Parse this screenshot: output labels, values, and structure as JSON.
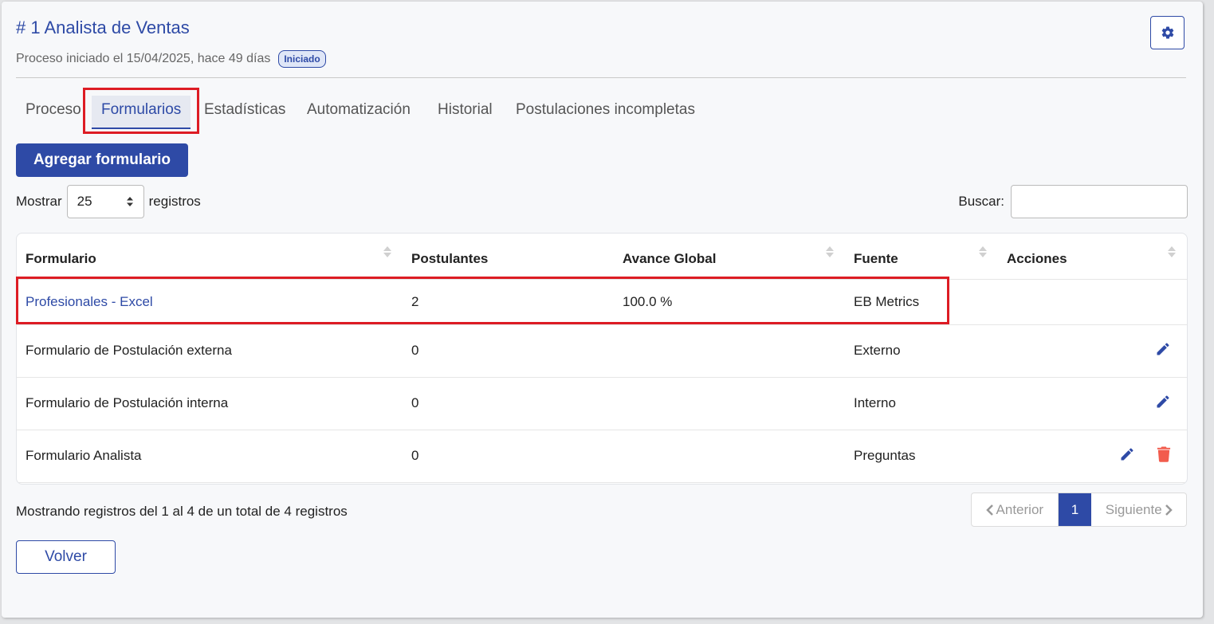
{
  "header": {
    "title": "# 1 Analista de Ventas",
    "subtitle": "Proceso iniciado el 15/04/2025, hace 49 días",
    "status_badge": "Iniciado",
    "settings_icon": "gear-icon"
  },
  "tabs": [
    {
      "label": "Proceso",
      "active": false
    },
    {
      "label": "Formularios",
      "active": true
    },
    {
      "label": "Estadísticas",
      "active": false
    },
    {
      "label": "Automatización",
      "active": false
    },
    {
      "label": "Historial",
      "active": false
    },
    {
      "label": "Postulaciones incompletas",
      "active": false
    }
  ],
  "toolbar": {
    "add_label": "Agregar formulario",
    "show_prefix": "Mostrar",
    "show_value": "25",
    "show_suffix": "registros",
    "search_label": "Buscar:",
    "search_value": ""
  },
  "table": {
    "columns": [
      "Formulario",
      "Postulantes",
      "Avance Global",
      "Fuente",
      "Acciones"
    ],
    "rows": [
      {
        "formulario": "Profesionales - Excel",
        "postulantes": "2",
        "avance": "100.0 %",
        "fuente": "EB Metrics",
        "actions": []
      },
      {
        "formulario": "Formulario de Postulación externa",
        "postulantes": "0",
        "avance": "",
        "fuente": "Externo",
        "actions": [
          "pencil-icon"
        ]
      },
      {
        "formulario": "Formulario de Postulación interna",
        "postulantes": "0",
        "avance": "",
        "fuente": "Interno",
        "actions": [
          "pencil-icon"
        ]
      },
      {
        "formulario": "Formulario Analista",
        "postulantes": "0",
        "avance": "",
        "fuente": "Preguntas",
        "actions": [
          "pencil-icon",
          "trash-icon"
        ]
      }
    ]
  },
  "footer": {
    "info": "Mostrando registros del 1 al 4 de un total de 4 registros",
    "prev_label": "Anterior",
    "current_page": "1",
    "next_label": "Siguiente",
    "back_label": "Volver"
  },
  "colors": {
    "primary": "#2e4aa6",
    "highlight": "#dd1c24",
    "danger": "#f25c4d"
  }
}
